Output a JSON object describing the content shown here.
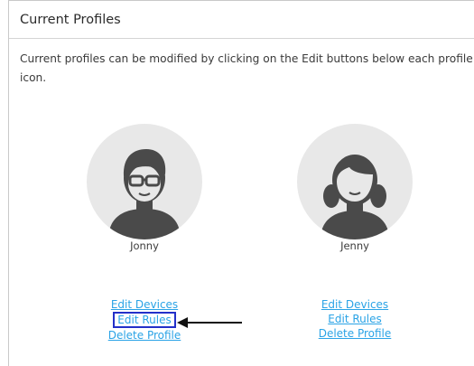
{
  "header": {
    "title": "Current Profiles"
  },
  "description": "Current profiles can be modified by clicking on the Edit buttons below each profile icon.",
  "profiles": [
    {
      "name": "Jonny",
      "icon": "boy-with-glasses-icon",
      "links": {
        "edit_devices": "Edit Devices",
        "edit_rules": "Edit Rules",
        "delete_profile": "Delete Profile"
      }
    },
    {
      "name": "Jenny",
      "icon": "girl-with-pigtails-icon",
      "links": {
        "edit_devices": "Edit Devices",
        "edit_rules": "Edit Rules",
        "delete_profile": "Delete Profile"
      }
    }
  ],
  "colors": {
    "link": "#2aa3e6",
    "highlight_border": "#2330c9",
    "avatar_bg": "#e8e8e8",
    "avatar_figure": "#4a4a4a"
  },
  "annotation": {
    "icon": "arrow-left-icon",
    "points_to": "edit_rules"
  }
}
